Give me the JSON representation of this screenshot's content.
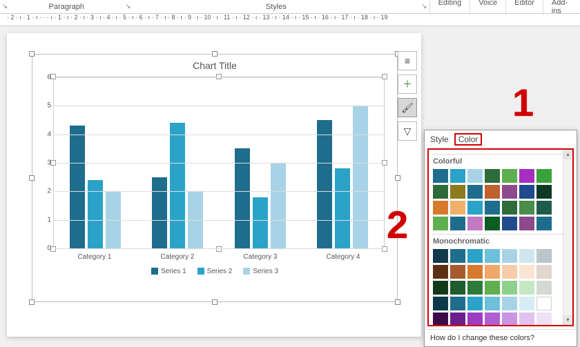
{
  "ribbon": {
    "launcher_glyph": "↘",
    "paragraph": "Paragraph",
    "styles": "Styles",
    "editing": "Editing",
    "voice": "Voice",
    "editor": "Editor",
    "addins": "Add-ins"
  },
  "ruler": "· 2 · ı · 1 · ı · · · ı · 1 · ı · 2 · ı · 3 · ı · 4 · ı · 5 · ı · 6 · ı · 7 · ı · 8 · ı · 9 · ı · 10 · ı · 11 · ı · 12 · ı · 13 · ı · 14 · ı · 15 · ı · 16 · ı · 17 · ı · 18 · ı · 19",
  "chart_data": {
    "type": "bar",
    "title": "Chart Title",
    "categories": [
      "Category 1",
      "Category 2",
      "Category 3",
      "Category 4"
    ],
    "series": [
      {
        "name": "Series 1",
        "values": [
          4.3,
          2.5,
          3.5,
          4.5
        ],
        "color": "#1f6d8c"
      },
      {
        "name": "Series 2",
        "values": [
          2.4,
          4.4,
          1.8,
          2.8
        ],
        "color": "#2ba3c9"
      },
      {
        "name": "Series 3",
        "values": [
          2.0,
          2.0,
          3.0,
          5.0
        ],
        "color": "#a8d3e6"
      }
    ],
    "ylim": [
      0,
      6
    ],
    "yticks": [
      0,
      1,
      2,
      3,
      4,
      5,
      6
    ]
  },
  "float_buttons": {
    "layout": "≡",
    "add": "＋",
    "brush": "🖌",
    "filter": "▽"
  },
  "panel": {
    "tab_style": "Style",
    "tab_color": "Color",
    "section_colorful": "Colorful",
    "section_mono": "Monochromatic",
    "footer": "How do I change these colors?",
    "scroll_up": "▴",
    "scroll_down": "▾",
    "palettes_colorful": [
      [
        "#1f6d8c",
        "#2ba3c9",
        "#a8d3e6",
        "#2e6b3a",
        "#5fae4f",
        "#a62fbf",
        "#3aa23a"
      ],
      [
        "#2e6b3a",
        "#8c7a1f",
        "#1f6d8c",
        "#bf612f",
        "#8c4a8c",
        "#1f4a8c",
        "#0d3a24"
      ],
      [
        "#d87a2e",
        "#efb06a",
        "#2ba3c9",
        "#1f6d8c",
        "#2e6b3a",
        "#4a8c4a",
        "#1f5c4a"
      ],
      [
        "#5fae4f",
        "#1f6d8c",
        "#c27ac2",
        "#0d5c24",
        "#1f4a8c",
        "#8c4a8c",
        "#1f6d8c"
      ]
    ],
    "palettes_mono": [
      [
        "#123a4a",
        "#1f6d8c",
        "#2ba3c9",
        "#6cc0da",
        "#a8d3e6",
        "#cfe6ef",
        "#b9c6cc"
      ],
      [
        "#5c3014",
        "#a65a2e",
        "#d87a2e",
        "#efa76a",
        "#f6ccab",
        "#fbe4d2",
        "#e0d6cd"
      ],
      [
        "#123a1a",
        "#1f5c2e",
        "#2e7a3a",
        "#5fae4f",
        "#8fd08c",
        "#c4e8c2",
        "#d3d9d1"
      ],
      [
        "#0d3a4a",
        "#1f6d8c",
        "#2ba3c9",
        "#6cc0da",
        "#a8d3e6",
        "#d6edf5",
        "#ffffff"
      ],
      [
        "#3a0d4a",
        "#6b1f8c",
        "#9c3cc2",
        "#b060d4",
        "#c994e0",
        "#e1c2ef",
        "#efe0f6"
      ]
    ]
  },
  "annotations": {
    "a1": "1",
    "a2": "2"
  }
}
